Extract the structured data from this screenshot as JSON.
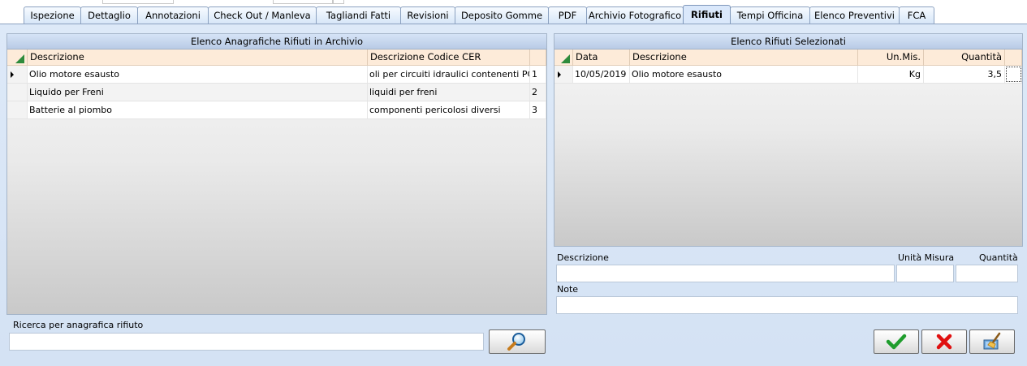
{
  "tabs": [
    {
      "label": "Ispezione"
    },
    {
      "label": "Dettaglio"
    },
    {
      "label": "Annotazioni"
    },
    {
      "label": "Check Out / Manleva"
    },
    {
      "label": "Tagliandi Fatti"
    },
    {
      "label": "Revisioni"
    },
    {
      "label": "Deposito Gomme"
    },
    {
      "label": "PDF"
    },
    {
      "label": "Archivio Fotografico"
    },
    {
      "label": "Rifiuti",
      "active": true
    },
    {
      "label": "Tempi Officina"
    },
    {
      "label": "Elenco Preventivi"
    },
    {
      "label": "FCA"
    }
  ],
  "left_grid": {
    "title": "Elenco Anagrafiche Rifiuti in Archivio",
    "columns": [
      "Descrizione",
      "Descrizione Codice CER",
      ""
    ],
    "rows": [
      {
        "descrizione": "Olio motore esausto",
        "cer": "oli per circuiti idraulici contenenti PCB (<...",
        "id": "1"
      },
      {
        "descrizione": "Liquido per Freni",
        "cer": "liquidi per freni",
        "id": "2"
      },
      {
        "descrizione": "Batterie al piombo",
        "cer": "componenti pericolosi diversi",
        "id": "3"
      }
    ]
  },
  "right_grid": {
    "title": "Elenco Rifiuti Selezionati",
    "columns": [
      "Data",
      "Descrizione",
      "Un.Mis.",
      "Quantità"
    ],
    "rows": [
      {
        "data": "10/05/2019",
        "descrizione": "Olio motore esausto",
        "unmis": "Kg",
        "quantita": "3,5"
      }
    ]
  },
  "form": {
    "descrizione_label": "Descrizione",
    "unita_label": "Unità Misura",
    "quantita_label": "Quantità",
    "note_label": "Note",
    "descrizione_value": "",
    "unita_value": "",
    "quantita_value": "",
    "note_value": ""
  },
  "search": {
    "label": "Ricerca per anagrafica rifiuto",
    "value": ""
  },
  "icons": {
    "search_button": "magnifier-icon",
    "confirm_button": "checkmark-icon",
    "cancel_button": "red-x-icon",
    "clear_button": "broom-icon"
  },
  "colors": {
    "panel_bg": "#d4e2f4",
    "header_bg": "#fdebd9",
    "title_bg": "#b9cbe6",
    "confirm": "#1f9d2d",
    "cancel": "#e01010"
  }
}
